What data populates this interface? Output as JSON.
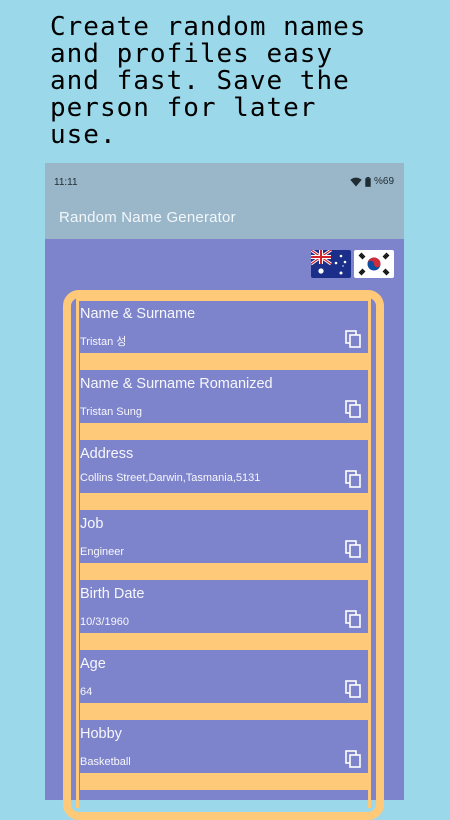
{
  "promo": {
    "text": "Create random names\nand profiles easy\nand fast. Save the\nperson for later\nuse."
  },
  "status": {
    "time": "11:11",
    "battery": "%69"
  },
  "app": {
    "title": "Random Name Generator"
  },
  "flags": [
    {
      "name": "australia-flag"
    },
    {
      "name": "south-korea-flag"
    }
  ],
  "fields": {
    "name": {
      "label": "Name & Surname",
      "value": "Tristan 성"
    },
    "romanized": {
      "label": "Name & Surname Romanized",
      "value": "Tristan Sung"
    },
    "address": {
      "label": "Address",
      "value": "Collins Street,Darwin,Tasmania,5131"
    },
    "job": {
      "label": "Job",
      "value": "Engineer"
    },
    "birth": {
      "label": "Birth Date",
      "value": "10/3/1960"
    },
    "age": {
      "label": "Age",
      "value": "64"
    },
    "hobby": {
      "label": "Hobby",
      "value": "Basketball"
    }
  },
  "colors": {
    "background": "#9ad8ea",
    "panel": "#7d84cb",
    "accent": "#ffc97a",
    "appbar": "#9ab6c9"
  }
}
